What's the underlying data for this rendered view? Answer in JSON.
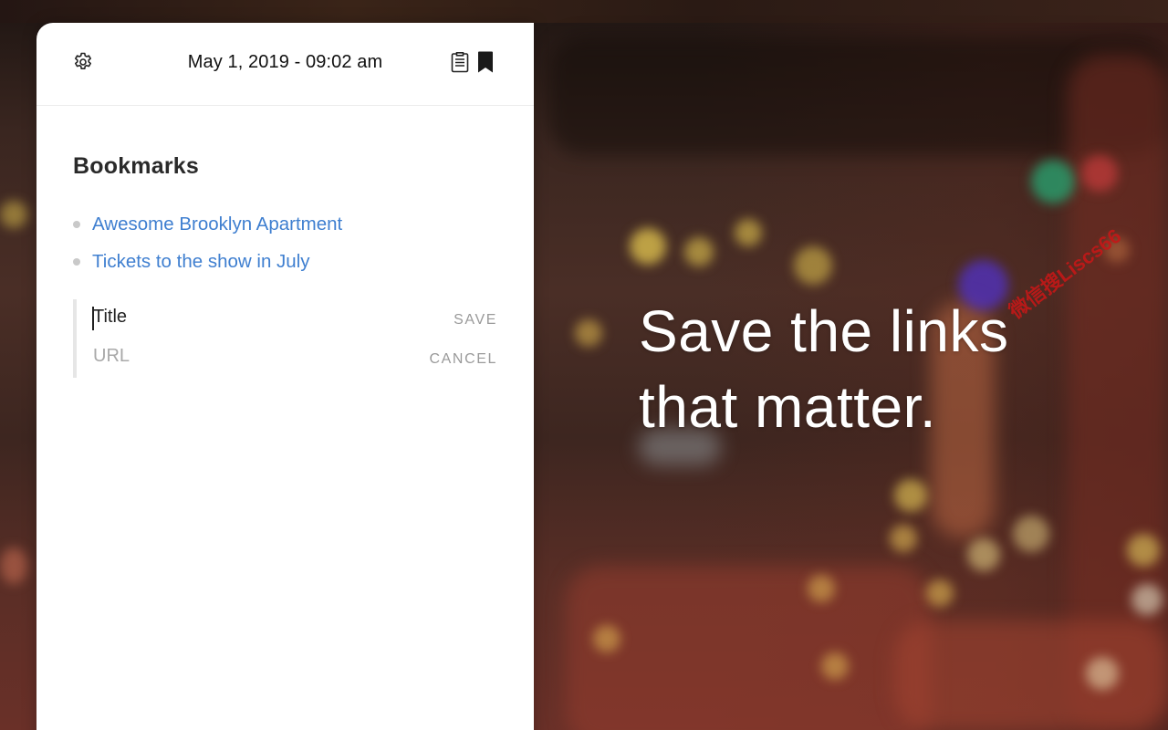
{
  "header": {
    "datetime": "May 1, 2019 - 09:02 am",
    "icons": [
      "gear-icon",
      "notes-icon",
      "bookmark-icon"
    ]
  },
  "bookmarks": {
    "title": "Bookmarks",
    "items": [
      {
        "label": "Awesome Brooklyn Apartment"
      },
      {
        "label": "Tickets to the show in July"
      }
    ]
  },
  "form": {
    "title_value": "Title",
    "url_placeholder": "URL",
    "save_label": "SAVE",
    "cancel_label": "CANCEL"
  },
  "tagline": {
    "line1": "Save the links",
    "line2": "that matter."
  },
  "watermark": "微信搜Liscs66",
  "colors": {
    "link": "#3f7fd0",
    "panel_bg": "#ffffff",
    "muted": "#9a9a9a",
    "tagline": "#ffffff"
  }
}
